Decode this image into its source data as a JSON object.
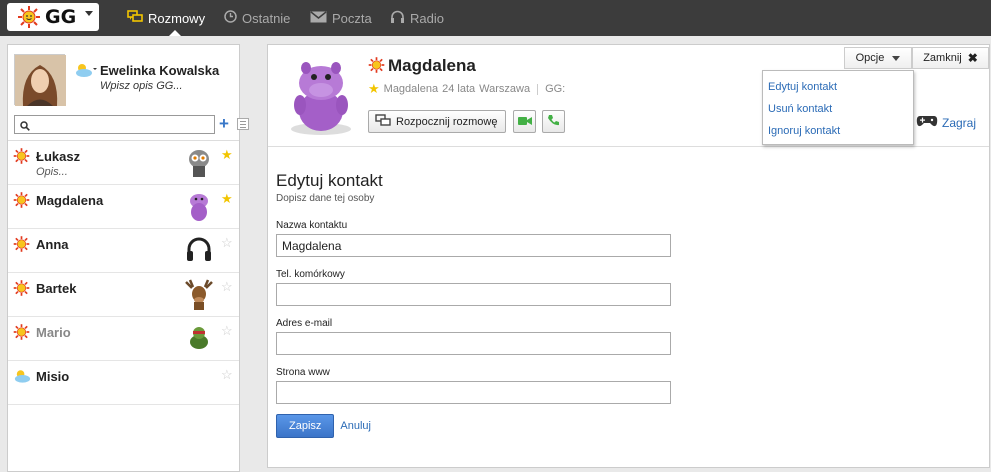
{
  "app": {
    "logo_text": "GG"
  },
  "nav": {
    "items": [
      {
        "label": "Rozmowy",
        "icon": "chat-bubbles-icon",
        "active": true
      },
      {
        "label": "Ostatnie",
        "icon": "clock-icon",
        "active": false
      },
      {
        "label": "Poczta",
        "icon": "envelope-icon",
        "active": false
      },
      {
        "label": "Radio",
        "icon": "headphones-icon",
        "active": false
      }
    ]
  },
  "me": {
    "name": "Ewelinka Kowalska",
    "description": "Wpisz opis GG..."
  },
  "search": {
    "placeholder": "",
    "value": ""
  },
  "contacts": [
    {
      "name": "Łukasz",
      "description": "Opis...",
      "status": "available",
      "favorite": true
    },
    {
      "name": "Magdalena",
      "description": "",
      "status": "available",
      "favorite": true
    },
    {
      "name": "Anna",
      "description": "",
      "status": "available",
      "favorite": false
    },
    {
      "name": "Bartek",
      "description": "",
      "status": "available",
      "favorite": false
    },
    {
      "name": "Mario",
      "description": "",
      "status": "available",
      "favorite": false
    },
    {
      "name": "Misio",
      "description": "",
      "status": "away",
      "favorite": false
    }
  ],
  "contact_header": {
    "name": "Magdalena",
    "meta_name": "Magdalena",
    "meta_age": "24 lata",
    "meta_city": "Warszawa",
    "meta_gg": "GG:",
    "start_chat_label": "Rozpocznij rozmowę",
    "options_label": "Opcje",
    "close_label": "Zamknij",
    "game_label": "Zagraj"
  },
  "options_menu": {
    "items": [
      "Edytuj kontakt",
      "Usuń kontakt",
      "Ignoruj kontakt"
    ]
  },
  "form": {
    "title": "Edytuj kontakt",
    "subtitle": "Dopisz dane tej osoby",
    "fields": [
      {
        "label": "Nazwa kontaktu",
        "value": "Magdalena"
      },
      {
        "label": "Tel. komórkowy",
        "value": ""
      },
      {
        "label": "Adres e-mail",
        "value": ""
      },
      {
        "label": "Strona www",
        "value": ""
      }
    ],
    "save_label": "Zapisz",
    "cancel_label": "Anuluj"
  },
  "colors": {
    "topbar": "#3c3c3c",
    "link": "#2b6bb6",
    "accent_button": "#3b74c8",
    "star": "#f2c500",
    "green_action": "#43b045"
  }
}
